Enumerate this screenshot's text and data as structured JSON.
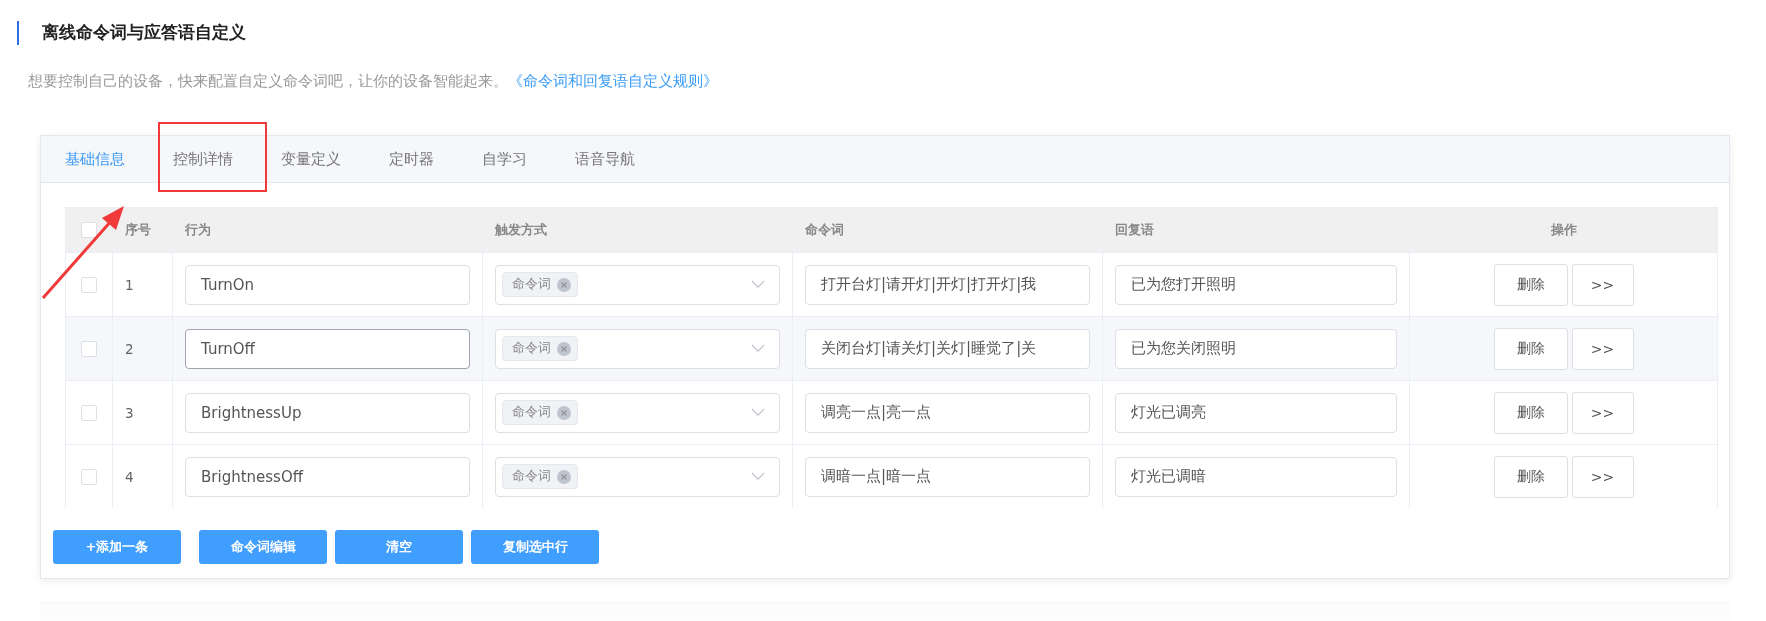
{
  "section": {
    "title": "离线命令词与应答语自定义",
    "description": "想要控制自己的设备，快来配置自定义命令词吧，让你的设备智能起来。",
    "rules_link": "《命令词和回复语自定义规则》"
  },
  "tabs": [
    {
      "label": "基础信息",
      "selected": true
    },
    {
      "label": "控制详情",
      "selected": false
    },
    {
      "label": "变量定义",
      "selected": false
    },
    {
      "label": "定时器",
      "selected": false
    },
    {
      "label": "自学习",
      "selected": false
    },
    {
      "label": "语音导航",
      "selected": false
    }
  ],
  "table": {
    "select_all": {
      "checked": false
    },
    "columns": [
      "序号",
      "行为",
      "触发方式",
      "命令词",
      "回复语",
      "操作"
    ],
    "rows": [
      {
        "checked": false,
        "highlighted": false,
        "index": "1",
        "action": "TurnOn",
        "trigger_tag": "命令词",
        "command": "打开台灯|请开灯|开灯|打开灯|我",
        "reply": "已为您打开照明",
        "delete": "删除",
        "more": ">>"
      },
      {
        "checked": false,
        "highlighted": true,
        "index": "2",
        "action": "TurnOff",
        "trigger_tag": "命令词",
        "command": "关闭台灯|请关灯|关灯|睡觉了|关",
        "reply": "已为您关闭照明",
        "delete": "删除",
        "more": ">>"
      },
      {
        "checked": false,
        "highlighted": false,
        "index": "3",
        "action": "BrightnessUp",
        "trigger_tag": "命令词",
        "command": "调亮一点|亮一点",
        "reply": "灯光已调亮",
        "delete": "删除",
        "more": ">>"
      },
      {
        "checked": false,
        "highlighted": false,
        "index": "4",
        "action": "BrightnessOff",
        "trigger_tag": "命令词",
        "command": "调暗一点|暗一点",
        "reply": "灯光已调暗",
        "delete": "删除",
        "more": ">>"
      }
    ]
  },
  "buttons": [
    "+添加一条",
    "命令词编辑",
    "清空",
    "复制选中行"
  ]
}
